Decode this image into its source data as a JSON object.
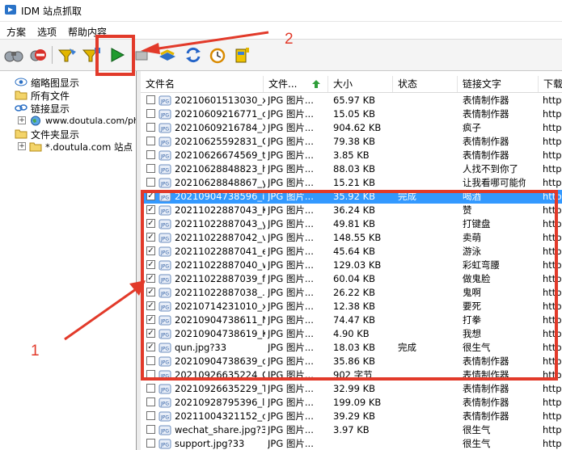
{
  "window": {
    "title": "IDM 站点抓取"
  },
  "menu": [
    "方案",
    "选项",
    "帮助内容"
  ],
  "toolbar_icons": [
    "binoculars-icon",
    "stop-sign-icon",
    "filter-icon",
    "filter-next-icon",
    "play-icon",
    "stop-flat-icon",
    "queue-icon",
    "refresh-icon",
    "alarm-clock-icon",
    "taxi-icon"
  ],
  "tree": [
    {
      "label": "缩略图显示",
      "icon": "eye-icon"
    },
    {
      "label": "所有文件",
      "icon": "folder-icon"
    },
    {
      "label": "链接显示",
      "icon": "link-icon"
    },
    {
      "label": "www.doutula.com/pho",
      "icon": "earth-icon",
      "expander": "+"
    },
    {
      "label": "文件夹显示",
      "icon": "folder-icon"
    },
    {
      "label": "*.doutula.com 站点",
      "icon": "folder-icon",
      "expander": "+"
    }
  ],
  "columns": [
    "文件名",
    "文件...",
    "大小",
    "状态",
    "链接文字",
    "下载"
  ],
  "rows": [
    {
      "checked": false,
      "name": "20210601513030_xl...",
      "type": "JPG 图片...",
      "size": "65.97 KB",
      "status": "",
      "link": "表情制作器",
      "url": "http:"
    },
    {
      "checked": false,
      "name": "20210609216771_ol...",
      "type": "JPG 图片...",
      "size": "15.05 KB",
      "status": "",
      "link": "表情制作器",
      "url": "http:"
    },
    {
      "checked": false,
      "name": "20210609216784_X...",
      "type": "JPG 图片...",
      "size": "904.62 KB",
      "status": "",
      "link": "疯子",
      "url": "http:"
    },
    {
      "checked": false,
      "name": "20210625592831_O...",
      "type": "JPG 图片...",
      "size": "79.38 KB",
      "status": "",
      "link": "表情制作器",
      "url": "http:"
    },
    {
      "checked": false,
      "name": "20210626674569_t...",
      "type": "JPG 图片...",
      "size": "3.85 KB",
      "status": "",
      "link": "表情制作器",
      "url": "http:"
    },
    {
      "checked": false,
      "name": "20210628848823_h...",
      "type": "JPG 图片...",
      "size": "88.03 KB",
      "status": "",
      "link": "人找不到你了",
      "url": "http:"
    },
    {
      "checked": false,
      "name": "20210628848867_y...",
      "type": "JPG 图片...",
      "size": "15.21 KB",
      "status": "",
      "link": "让我看哪可能你",
      "url": "http:"
    },
    {
      "checked": true,
      "selected": true,
      "name": "20210904738596_i...",
      "type": "JPG 图片...",
      "size": "35.92 KB",
      "status": "完成",
      "link": "喝酒",
      "url": "http:"
    },
    {
      "checked": true,
      "name": "20211022887043_K...",
      "type": "JPG 图片...",
      "size": "36.24 KB",
      "status": "",
      "link": "赞",
      "url": "http:"
    },
    {
      "checked": true,
      "name": "20211022887043_y...",
      "type": "JPG 图片...",
      "size": "49.81 KB",
      "status": "",
      "link": "打键盘",
      "url": "http:"
    },
    {
      "checked": true,
      "name": "20211022887042_v...",
      "type": "JPG 图片...",
      "size": "148.55 KB",
      "status": "",
      "link": "卖萌",
      "url": "http:"
    },
    {
      "checked": true,
      "name": "20211022887041_e...",
      "type": "JPG 图片...",
      "size": "45.64 KB",
      "status": "",
      "link": "游泳",
      "url": "http:"
    },
    {
      "checked": true,
      "name": "20211022887040_w...",
      "type": "JPG 图片...",
      "size": "129.03 KB",
      "status": "",
      "link": "彩虹弯腰",
      "url": "http:"
    },
    {
      "checked": true,
      "name": "20211022887039_f...",
      "type": "JPG 图片...",
      "size": "60.04 KB",
      "status": "",
      "link": "做鬼脸",
      "url": "http:"
    },
    {
      "checked": true,
      "name": "20211022887038_...",
      "type": "JPG 图片...",
      "size": "26.22 KB",
      "status": "",
      "link": "鬼啊",
      "url": "http:"
    },
    {
      "checked": true,
      "name": "20210714231010_x...",
      "type": "JPG 图片...",
      "size": "12.38 KB",
      "status": "",
      "link": "要死",
      "url": "http:"
    },
    {
      "checked": true,
      "name": "20210904738611_N...",
      "type": "JPG 图片...",
      "size": "74.47 KB",
      "status": "",
      "link": "打拳",
      "url": "http:"
    },
    {
      "checked": true,
      "name": "20210904738619_K...",
      "type": "JPG 图片...",
      "size": "4.90 KB",
      "status": "",
      "link": "我想",
      "url": "http:"
    },
    {
      "checked": true,
      "name": "qun.jpg?33",
      "type": "JPG 图片...",
      "size": "18.03 KB",
      "status": "完成",
      "link": "很生气",
      "url": "http:"
    },
    {
      "checked": false,
      "name": "20210904738639_q...",
      "type": "JPG 图片...",
      "size": "35.86 KB",
      "status": "",
      "link": "表情制作器",
      "url": "http:"
    },
    {
      "checked": false,
      "name": "20210926635224_Q...",
      "type": "JPG 图片...",
      "size": "902 字节",
      "status": "",
      "link": "表情制作器",
      "url": "http:"
    },
    {
      "checked": false,
      "name": "20210926635229_T...",
      "type": "JPG 图片...",
      "size": "32.99 KB",
      "status": "",
      "link": "表情制作器",
      "url": "http:"
    },
    {
      "checked": false,
      "name": "20210928795396_lZ...",
      "type": "JPG 图片...",
      "size": "199.09 KB",
      "status": "",
      "link": "表情制作器",
      "url": "http:"
    },
    {
      "checked": false,
      "name": "20211004321152_c...",
      "type": "JPG 图片...",
      "size": "39.29 KB",
      "status": "",
      "link": "表情制作器",
      "url": "http:"
    },
    {
      "checked": false,
      "name": "wechat_share.jpg?33",
      "type": "JPG 图片...",
      "size": "3.97 KB",
      "status": "",
      "link": "很生气",
      "url": "http:"
    },
    {
      "checked": false,
      "name": "support.jpg?33",
      "type": "JPG 图片...",
      "size": "",
      "status": "",
      "link": "很生气",
      "url": "http:"
    }
  ],
  "annotations": {
    "label1": "1",
    "label2": "2",
    "color": "#e23a2a"
  }
}
